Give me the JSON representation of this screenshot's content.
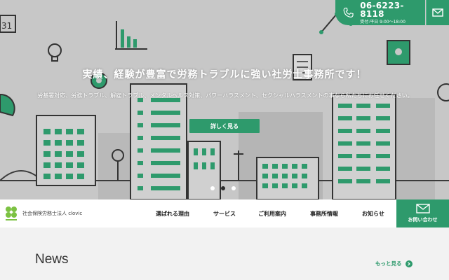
{
  "header": {
    "phone_number": "06-6223-8118",
    "phone_hours": "受付:平日 9:00〜18:00"
  },
  "hero": {
    "headline": "実績、経験が豊富で労務トラブルに強い社労士事務所です！",
    "subtext": "労基署対応、労務トラブル、解雇トラブル、メンタルヘルス対策、パワーハラスメント、セクシャルハラスメントの事なら私たちにお任せください。",
    "cta_label": "詳しく見る",
    "slides": 3,
    "active_slide": 2
  },
  "nav": {
    "brand_name": "社会保険労務士法人 clovic",
    "items": [
      "選ばれる理由",
      "サービス",
      "ご利用案内",
      "事務所情報",
      "お知らせ"
    ],
    "contact_label": "お問い合わせ"
  },
  "news": {
    "title": "News",
    "more_label": "もっと見る"
  },
  "colors": {
    "brand_green": "#2e9a6c",
    "hero_gray": "#c7c7c7",
    "page_bg": "#f2f2f2"
  }
}
